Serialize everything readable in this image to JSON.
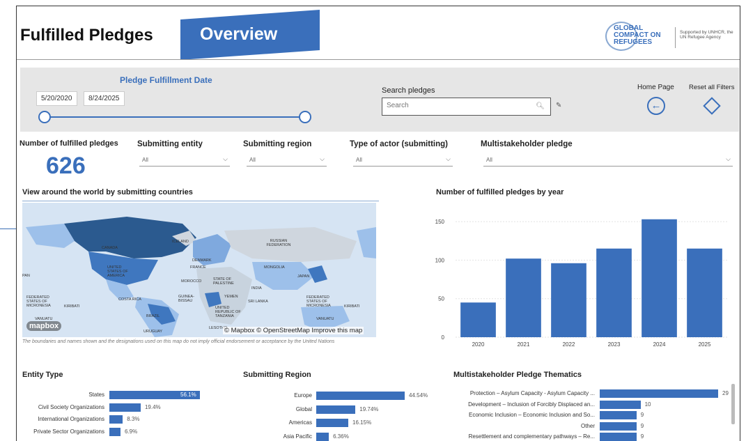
{
  "header": {
    "title": "Fulfilled Pledges",
    "banner": "Overview",
    "logo_text": "GLOBAL COMPACT ON REFUGEES",
    "supported_by": "Supported by UNHCR, the UN Refugee Agency"
  },
  "filters": {
    "date_label": "Pledge Fulfillment Date",
    "date_start": "5/20/2020",
    "date_end": "8/24/2025",
    "search_label": "Search pledges",
    "search_placeholder": "Search",
    "home_label": "Home Page",
    "reset_label": "Reset all Filters"
  },
  "kpi": {
    "label": "Number of fulfilled pledges",
    "value": "626"
  },
  "slicers": [
    {
      "label": "Submitting entity",
      "value": "All"
    },
    {
      "label": "Submitting region",
      "value": "All"
    },
    {
      "label": "Type of actor (submitting)",
      "value": "All"
    },
    {
      "label": "Multistakeholder pledge",
      "value": "All"
    }
  ],
  "map": {
    "title": "View around the world by submitting countries",
    "labels": [
      "CANADA",
      "ICELAND",
      "RUSSIAN FEDERATION",
      "UNITED STATES OF AMERICA",
      "DENMARK",
      "FRANCE",
      "MONGOLIA",
      "JAPAN",
      "MOROCCO",
      "STATE OF PALESTINE",
      "INDIA",
      "COSTA RICA",
      "GUINEA-BISSAU",
      "YEMEN",
      "SRI LANKA",
      "FEDERATED STATES OF MICRONESIA",
      "KIRIBATI",
      "BRAZIL",
      "UNITED REPUBLIC OF TANZANIA",
      "VANUATU",
      "URUGUAY",
      "LESOTHO",
      "JAPAN",
      "PAN"
    ],
    "credit": "© Mapbox © OpenStreetMap Improve this map",
    "mapbox_logo": "mapbox",
    "disclaimer": "The boundaries and names shown and the designations used on this map do not imply official endorsement or acceptance by the United Nations"
  },
  "chart_data": [
    {
      "type": "bar",
      "title": "Number of fulfilled pledges by year",
      "categories": [
        "2020",
        "2021",
        "2022",
        "2023",
        "2024",
        "2025"
      ],
      "values": [
        45,
        102,
        96,
        115,
        153,
        115
      ],
      "ylim": [
        0,
        160
      ],
      "yticks": [
        0,
        50,
        100,
        150
      ],
      "grid": true,
      "color": "#3a6fbb"
    },
    {
      "type": "bar",
      "orientation": "horizontal",
      "title": "Entity Type",
      "categories": [
        "States",
        "Civil Society Organizations",
        "International Organizations",
        "Private Sector Organizations"
      ],
      "values": [
        56.1,
        19.4,
        8.3,
        6.9
      ],
      "value_labels": [
        "56.1%",
        "19.4%",
        "8.3%",
        "6.9%"
      ],
      "color": "#3a6fbb"
    },
    {
      "type": "bar",
      "orientation": "horizontal",
      "title": "Submitting Region",
      "categories": [
        "Europe",
        "Global",
        "Americas",
        "Asia Pacific"
      ],
      "values": [
        44.54,
        19.74,
        16.15,
        6.36
      ],
      "value_labels": [
        "44.54%",
        "19.74%",
        "16.15%",
        "6.36%"
      ],
      "color": "#3a6fbb"
    },
    {
      "type": "bar",
      "orientation": "horizontal",
      "title": "Multistakeholder Pledge Thematics",
      "categories": [
        "Protection – Asylum Capacity - Asylum Capacity ...",
        "Development – Inclusion of Forcibly Displaced an...",
        "Economic Inclusion – Economic Inclusion and So...",
        "Other",
        "Resettlement and complementary pathways – Re..."
      ],
      "values": [
        29,
        10,
        9,
        9,
        9
      ],
      "value_labels": [
        "29",
        "10",
        "9",
        "9",
        "9"
      ],
      "color": "#3a6fbb"
    }
  ]
}
